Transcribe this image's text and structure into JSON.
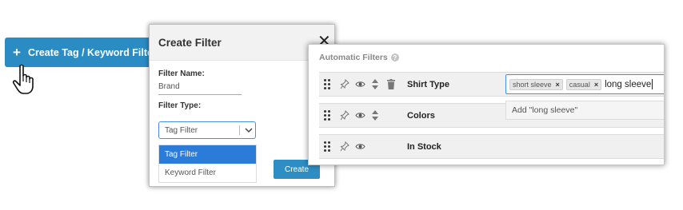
{
  "create_button": {
    "label": "Create Tag / Keyword Filter",
    "icon": "plus-icon"
  },
  "modal": {
    "title": "Create Filter",
    "close_icon": "close-icon",
    "filter_name_label": "Filter Name:",
    "filter_name_value": "Brand",
    "filter_type_label": "Filter Type:",
    "filter_type_value": "Tag Filter",
    "options": [
      "Tag Filter",
      "Keyword Filter"
    ],
    "create_label": "Create"
  },
  "panel": {
    "title": "Automatic Filters",
    "help_icon": "question-icon",
    "rows": [
      {
        "label": "Shirt Type",
        "icons": [
          "drag-handle-icon",
          "pin-icon",
          "eye-icon",
          "sort-icon",
          "trash-icon"
        ]
      },
      {
        "label": "Colors",
        "icons": [
          "drag-handle-icon",
          "pin-icon",
          "eye-icon",
          "sort-icon"
        ]
      },
      {
        "label": "In Stock",
        "icons": [
          "drag-handle-icon",
          "pin-icon",
          "eye-icon"
        ]
      }
    ],
    "tags": [
      "short sleeve",
      "casual"
    ],
    "typed_text": "long sleeve",
    "suggestion": "Add \"long sleeve\""
  },
  "colors": {
    "accent": "#2b8cc4",
    "selected": "#2b7bd8"
  }
}
